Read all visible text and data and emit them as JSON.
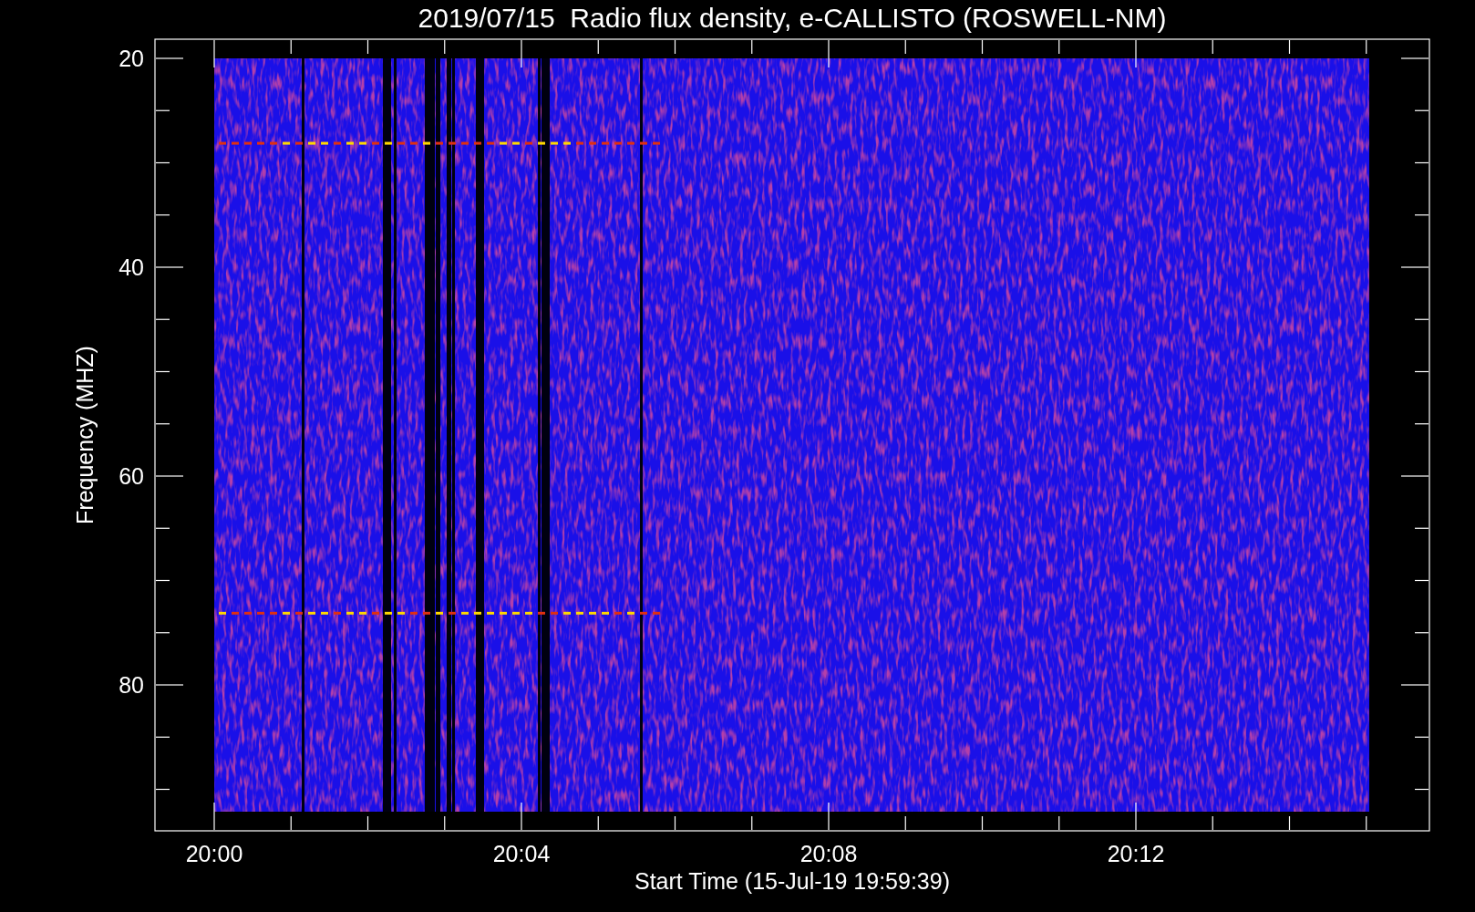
{
  "title": "2019/07/15  Radio flux density, e-CALLISTO (ROSWELL-NM)",
  "plot": {
    "ylabel": "Frequency (MHZ)",
    "xlabel": "Start Time (15-Jul-19 19:59:39)",
    "yticks": [
      "20",
      "40",
      "60",
      "80"
    ],
    "xticks": [
      "20:00",
      "20:04",
      "20:08",
      "20:12"
    ]
  }
}
